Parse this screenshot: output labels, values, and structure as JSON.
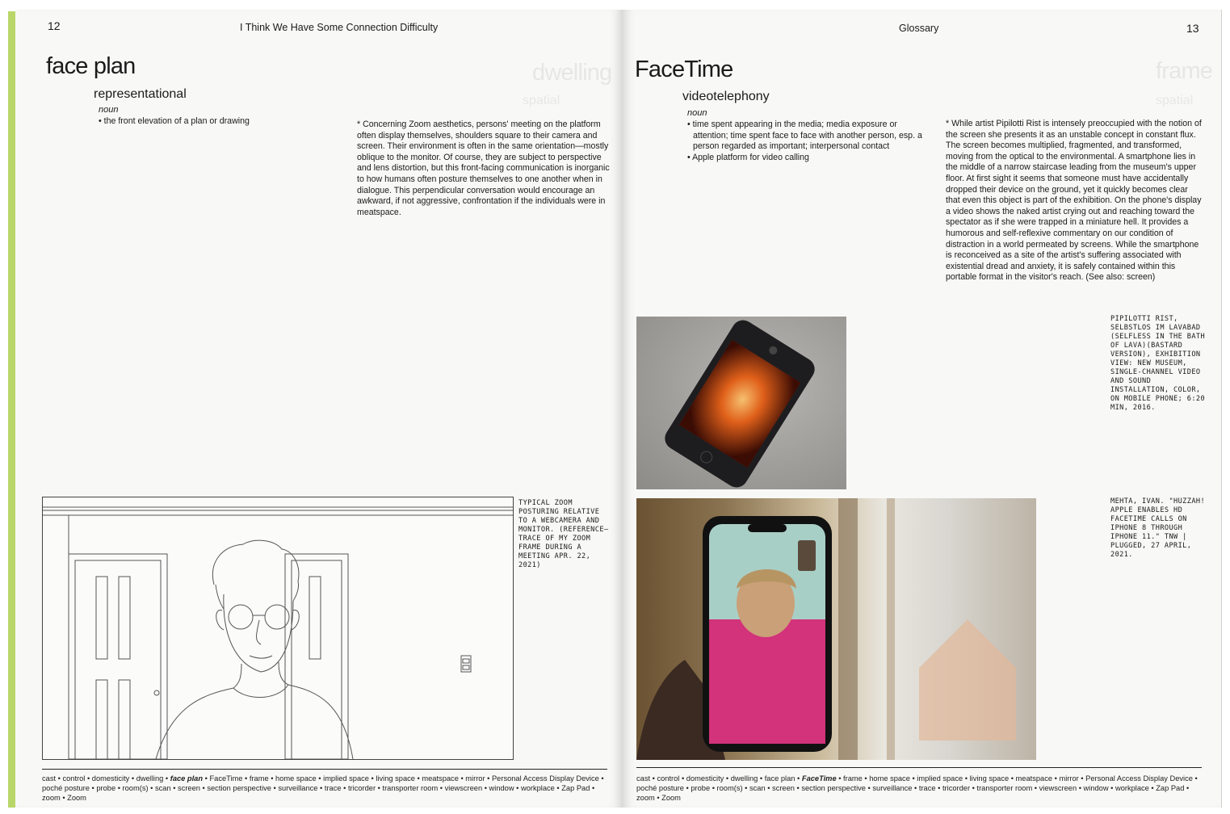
{
  "left_page": {
    "page_number": "12",
    "running_head": "I Think We Have Some Connection Difficulty",
    "headword": "face plan",
    "subword": "representational",
    "part_of_speech": "noun",
    "definitions": [
      "the front elevation of a plan or drawing"
    ],
    "note": "* Concerning Zoom aesthetics, persons' meeting on the platform often display themselves, shoulders square to their camera and screen. Their environment is often in the same orientation—mostly oblique to the monitor. Of course, they are subject to perspective and lens distortion, but this front-facing communication is inorganic to how humans often posture themselves to one another when in dialogue. This perpendicular conversation would encourage an awkward, if not aggressive, confrontation if the individuals were in meatspace.",
    "caption": "TYPICAL ZOOM POSTURING RELATIVE TO A WEBCAMERA AND MONITOR. (REFERENCE—TRACE OF MY ZOOM FRAME DURING A MEETING APR. 22, 2021)",
    "footer_before": "cast • control • domesticity • dwelling • ",
    "footer_current": "face plan",
    "footer_after": " • FaceTime • frame • home space • implied space • living space • meatspace • mirror • Personal Access Display Device • poché posture • probe • room(s) • scan • screen • section perspective • surveillance • trace • tricorder • transporter room • viewscreen • window • workplace • Zap Pad • zoom • Zoom",
    "show_through": {
      "headword": "dwelling",
      "subword": "spatial"
    }
  },
  "right_page": {
    "page_number": "13",
    "running_head": "Glossary",
    "headword": "FaceTime",
    "subword": "videotelephony",
    "part_of_speech": "noun",
    "definitions": [
      "time spent appearing in the media; media exposure or attention; time spent face to face with another person, esp. a person regarded as important; interpersonal contact",
      "Apple platform for video calling"
    ],
    "note": "* While artist Pipilotti Rist is intensely preoccupied with the notion of the screen she presents it as an unstable concept in constant flux. The screen becomes multiplied, fragmented, and transformed, moving from the optical to the environmental. A smartphone lies in the middle of a narrow staircase leading from the museum's upper floor. At first sight it seems that someone must have accidentally dropped their device on the ground, yet it quickly becomes clear that even this object is part of the exhibition. On the phone's display a video shows the naked artist crying out and reaching toward the spectator as if she were trapped in a miniature hell. It provides a humorous and self-reflexive commentary on our condition of distraction in a world permeated by screens. While the smartphone is reconceived as a site of the artist's suffering associated with existential dread and anxiety, it is safely contained within this portable format in the visitor's reach. (See also: screen)",
    "caption_1": "PIPILOTTI RIST, SELBSTLOS IM LAVABAD (SELFLESS IN THE BATH OF LAVA)(BASTARD VERSION), EXHIBITION VIEW: NEW MUSEUM, SINGLE-CHANNEL VIDEO AND SOUND INSTALLATION, COLOR, ON MOBILE PHONE; 6:20 MIN, 2016.",
    "caption_2": "MEHTA, IVAN. \"HUZZAH! APPLE ENABLES HD FACETIME CALLS ON IPHONE 8 THROUGH IPHONE 11.\" TNW | PLUGGED, 27 APRIL, 2021.",
    "footer_before": "cast • control • domesticity • dwelling • face plan • ",
    "footer_current": "FaceTime",
    "footer_after": " • frame • home space • implied space • living space • meatspace • mirror • Personal Access Display Device • poché posture • probe • room(s) • scan • screen • section perspective • surveillance • trace • tricorder • transporter room • viewscreen • window • workplace • Zap Pad • zoom • Zoom",
    "show_through": {
      "headword": "frame",
      "subword": "spatial"
    }
  },
  "colors": {
    "spine_edge": "#b9d66a",
    "paper": "#f8f8f7",
    "ink": "#1a1a1a"
  }
}
